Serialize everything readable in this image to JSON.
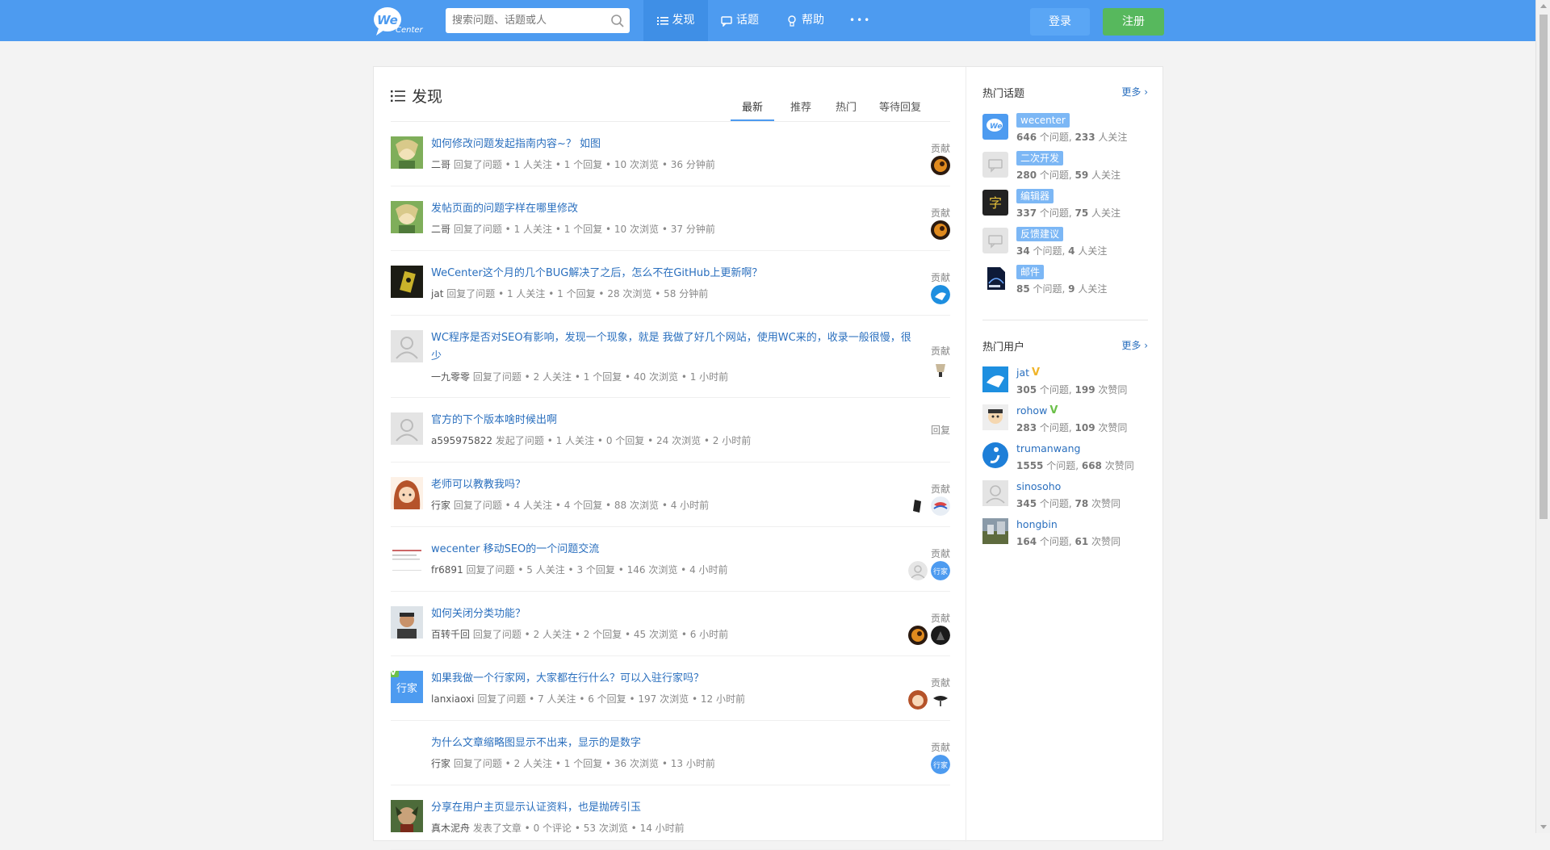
{
  "header": {
    "logo_text_1": "We",
    "logo_text_2": "Center",
    "search_placeholder": "搜索问题、话题或人",
    "nav": [
      {
        "label": "发现",
        "icon": "list-icon",
        "active": true
      },
      {
        "label": "话题",
        "icon": "chat-bubble-icon",
        "active": false
      },
      {
        "label": "帮助",
        "icon": "lightbulb-icon",
        "active": false
      },
      {
        "label": "•••",
        "icon": "more-icon",
        "active": false
      }
    ],
    "login_label": "登录",
    "register_label": "注册"
  },
  "main": {
    "title": "发现",
    "tabs": [
      {
        "label": "最新",
        "active": true
      },
      {
        "label": "推荐",
        "active": false
      },
      {
        "label": "热门",
        "active": false
      },
      {
        "label": "等待回复",
        "active": false
      }
    ]
  },
  "feed": [
    {
      "title": "如何修改问题发起指南内容~？ 如图",
      "user": "二哥",
      "action": "回复了问题",
      "follows": "1 人关注",
      "replies": "1 个回复",
      "views": "10 次浏览",
      "time": "36 分钟前",
      "side_label": "贡献"
    },
    {
      "title": "发帖页面的问题字样在哪里修改",
      "user": "二哥",
      "action": "回复了问题",
      "follows": "1 人关注",
      "replies": "1 个回复",
      "views": "10 次浏览",
      "time": "37 分钟前",
      "side_label": "贡献"
    },
    {
      "title": "WeCenter这个月的几个BUG解决了之后，怎么不在GitHub上更新啊？",
      "user": "jat",
      "action": "回复了问题",
      "follows": "1 人关注",
      "replies": "1 个回复",
      "views": "28 次浏览",
      "time": "58 分钟前",
      "side_label": "贡献"
    },
    {
      "title": "WC程序是否对SEO有影响，发现一个现象，就是 我做了好几个网站，使用WC来的，收录一般很慢，很少",
      "user": "一九零零",
      "action": "回复了问题",
      "follows": "2 人关注",
      "replies": "1 个回复",
      "views": "40 次浏览",
      "time": "1 小时前",
      "side_label": "贡献"
    },
    {
      "title": "官方的下个版本啥时候出啊",
      "user": "a595975822",
      "action": "发起了问题",
      "follows": "1 人关注",
      "replies": "0 个回复",
      "views": "24 次浏览",
      "time": "2 小时前",
      "side_label": "回复"
    },
    {
      "title": "老师可以教教我吗？",
      "user": "行家",
      "action": "回复了问题",
      "follows": "4 人关注",
      "replies": "4 个回复",
      "views": "88 次浏览",
      "time": "4 小时前",
      "side_label": "贡献"
    },
    {
      "title": "wecenter 移动SEO的一个问题交流",
      "user": "fr6891",
      "action": "回复了问题",
      "follows": "5 人关注",
      "replies": "3 个回复",
      "views": "146 次浏览",
      "time": "4 小时前",
      "side_label": "贡献"
    },
    {
      "title": "如何关闭分类功能？",
      "user": "百转千回",
      "action": "回复了问题",
      "follows": "2 人关注",
      "replies": "2 个回复",
      "views": "45 次浏览",
      "time": "6 小时前",
      "side_label": "贡献"
    },
    {
      "title": "如果我做一个行家网，大家都在行什么？可以入驻行家吗？",
      "user": "lanxiaoxi",
      "action": "回复了问题",
      "follows": "7 人关注",
      "replies": "6 个回复",
      "views": "197 次浏览",
      "time": "12 小时前",
      "side_label": "贡献"
    },
    {
      "title": "为什么文章缩略图显示不出来，显示的是数字",
      "user": "行家",
      "action": "回复了问题",
      "follows": "2 人关注",
      "replies": "1 个回复",
      "views": "36 次浏览",
      "time": "13 小时前",
      "side_label": "贡献"
    },
    {
      "title": "分享在用户主页显示认证资料，也是抛砖引玉",
      "user": "真木泥舟",
      "action": "发表了文章",
      "follows": "0 个评论",
      "replies": "53 次浏览",
      "views": "14 小时前",
      "time": "",
      "side_label": ""
    }
  ],
  "sidebar": {
    "topics_title": "热门话题",
    "topics_more": "更多 ›",
    "topics": [
      {
        "name": "wecenter",
        "questions": "646",
        "q_unit": " 个问题, ",
        "follows": "233",
        "f_unit": " 人关注"
      },
      {
        "name": "二次开发",
        "questions": "280",
        "q_unit": " 个问题, ",
        "follows": "59",
        "f_unit": " 人关注"
      },
      {
        "name": "编辑器",
        "questions": "337",
        "q_unit": " 个问题, ",
        "follows": "75",
        "f_unit": " 人关注"
      },
      {
        "name": "反馈建议",
        "questions": "34",
        "q_unit": " 个问题, ",
        "follows": "4",
        "f_unit": " 人关注"
      },
      {
        "name": "邮件",
        "questions": "85",
        "q_unit": " 个问题, ",
        "follows": "9",
        "f_unit": " 人关注"
      }
    ],
    "users_title": "热门用户",
    "users_more": "更多 ›",
    "users": [
      {
        "name": "jat",
        "verified": "V",
        "badge_color": "#f0b429",
        "questions": "305",
        "q_unit": " 个问题, ",
        "agrees": "199",
        "a_unit": " 次赞同"
      },
      {
        "name": "rohow",
        "verified": "V",
        "badge_color": "#6cc04a",
        "questions": "283",
        "q_unit": " 个问题, ",
        "agrees": "109",
        "a_unit": " 次赞同"
      },
      {
        "name": "trumanwang",
        "verified": "",
        "badge_color": "",
        "questions": "1555",
        "q_unit": " 个问题, ",
        "agrees": "668",
        "a_unit": " 次赞同"
      },
      {
        "name": "sinosoho",
        "verified": "",
        "badge_color": "",
        "questions": "345",
        "q_unit": " 个问题, ",
        "agrees": "78",
        "a_unit": " 次赞同"
      },
      {
        "name": "hongbin",
        "verified": "",
        "badge_color": "",
        "questions": "164",
        "q_unit": " 个问题, ",
        "agrees": "61",
        "a_unit": " 次赞同"
      }
    ]
  },
  "colors": {
    "brand": "#4d9bf0",
    "link": "#2a6fbe",
    "register": "#57b85d",
    "tag": "#7cb7f5"
  }
}
